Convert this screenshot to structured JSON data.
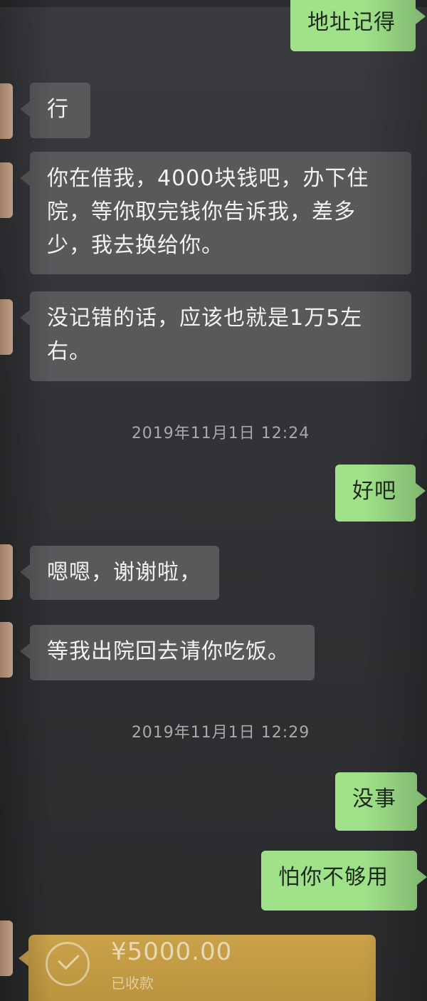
{
  "messages": [
    {
      "id": "m1",
      "side": "out",
      "text": "地址记得"
    },
    {
      "id": "m2",
      "side": "in",
      "text": "行"
    },
    {
      "id": "m3",
      "side": "in",
      "text": "你在借我，4000块钱吧，办下住院，等你取完钱你告诉我，差多少，我去换给你。"
    },
    {
      "id": "m4",
      "side": "in",
      "text": "没记错的话，应该也就是1万5左右。"
    },
    {
      "id": "m5",
      "side": "out",
      "text": "好吧"
    },
    {
      "id": "m6",
      "side": "in",
      "text": "嗯嗯，谢谢啦，"
    },
    {
      "id": "m7",
      "side": "in",
      "text": "等我出院回去请你吃饭。"
    },
    {
      "id": "m8",
      "side": "out",
      "text": "没事"
    },
    {
      "id": "m9",
      "side": "out",
      "text": "怕你不够用"
    }
  ],
  "timestamps": [
    "2019年11月1日 12:24",
    "2019年11月1日 12:29"
  ],
  "transfer": {
    "amount": "¥5000.00",
    "status": "已收款",
    "icon": "check-circle-icon"
  },
  "colors": {
    "background": "#323336",
    "incoming_bubble": "#59595c",
    "outgoing_bubble": "#9fe28a",
    "transfer_bubble": "#c9a24a",
    "timestamp_text": "#a9a9ab"
  }
}
